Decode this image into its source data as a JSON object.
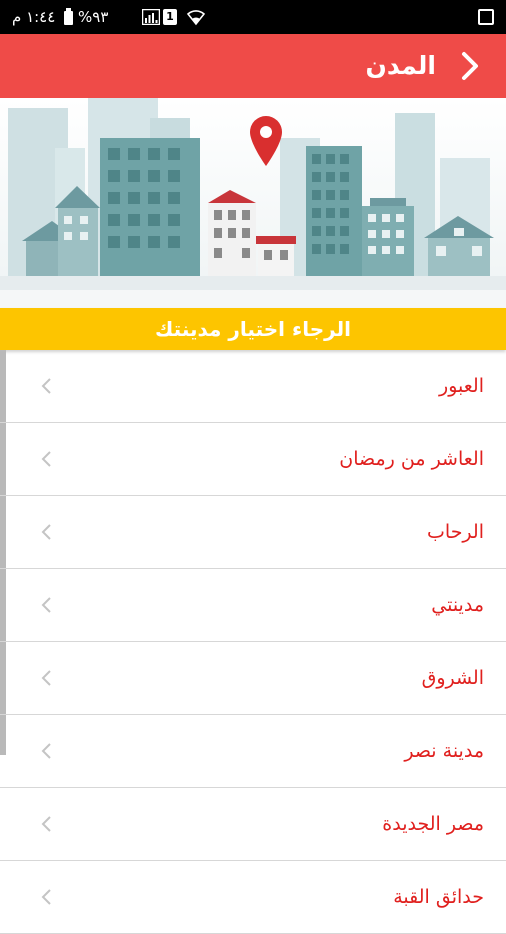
{
  "status_bar": {
    "time": "١:٤٤ م",
    "battery_percent": "%٩٣",
    "sim_label": "1",
    "icons": [
      "battery-icon",
      "signal-icon",
      "sim-icon",
      "wifi-icon",
      "gallery-icon"
    ]
  },
  "header": {
    "title": "المدن",
    "back_icon": "chevron-right-icon",
    "background_color": "#ef4b48"
  },
  "banner": {
    "illustration": "city-skyline-with-location-pin"
  },
  "prompt": {
    "text": "الرجاء اختيار مدينتك",
    "background_color": "#fdc500"
  },
  "cities": [
    {
      "label": "العبور"
    },
    {
      "label": "العاشر من رمضان"
    },
    {
      "label": "الرحاب"
    },
    {
      "label": "مدينتي"
    },
    {
      "label": "الشروق"
    },
    {
      "label": "مدينة نصر"
    },
    {
      "label": "مصر الجديدة"
    },
    {
      "label": "حدائق القبة"
    }
  ],
  "colors": {
    "city_text": "#e0201e",
    "divider": "#d7d7d7",
    "chevron": "#c4c4c4"
  }
}
